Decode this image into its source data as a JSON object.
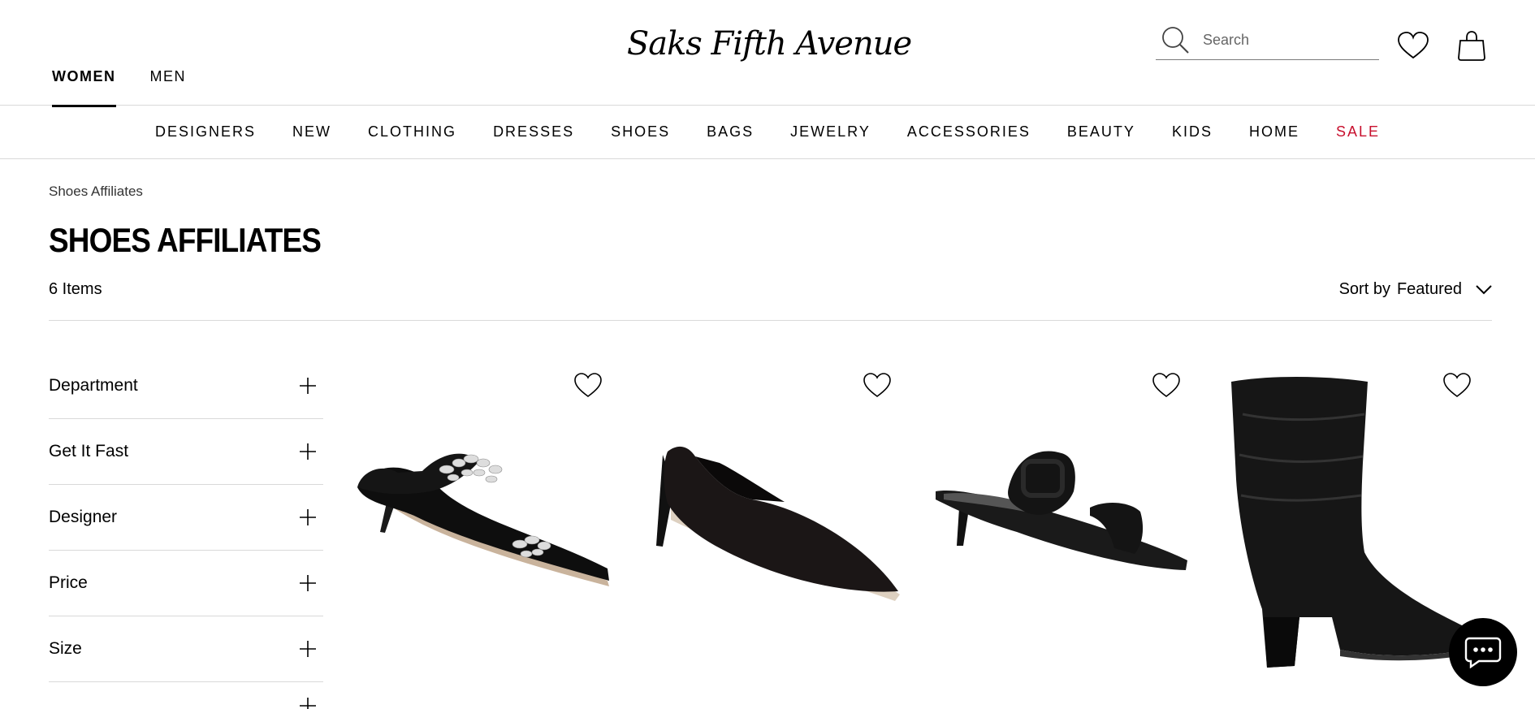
{
  "header": {
    "tabs": [
      {
        "label": "WOMEN",
        "active": true
      },
      {
        "label": "MEN",
        "active": false
      }
    ],
    "logo_text": "Saks Fifth Avenue",
    "search": {
      "placeholder": "Search",
      "value": ""
    },
    "icons": [
      "search-icon",
      "heart-icon",
      "shopping-bag-icon"
    ]
  },
  "nav": {
    "items": [
      "DESIGNERS",
      "NEW",
      "CLOTHING",
      "DRESSES",
      "SHOES",
      "BAGS",
      "JEWELRY",
      "ACCESSORIES",
      "BEAUTY",
      "KIDS",
      "HOME",
      "SALE"
    ],
    "sale_color": "#c8102e"
  },
  "page": {
    "breadcrumb": "Shoes Affiliates",
    "title": "SHOES AFFILIATES",
    "item_count": "6 Items",
    "sort_label": "Sort by",
    "sort_value": "Featured"
  },
  "filters": [
    "Department",
    "Get It Fast",
    "Designer",
    "Price",
    "Size"
  ],
  "products": [
    {
      "type": "embellished-satin-mule"
    },
    {
      "type": "suede-pump"
    },
    {
      "type": "buckle-slide-sandal"
    },
    {
      "type": "leather-slouch-boot"
    }
  ]
}
